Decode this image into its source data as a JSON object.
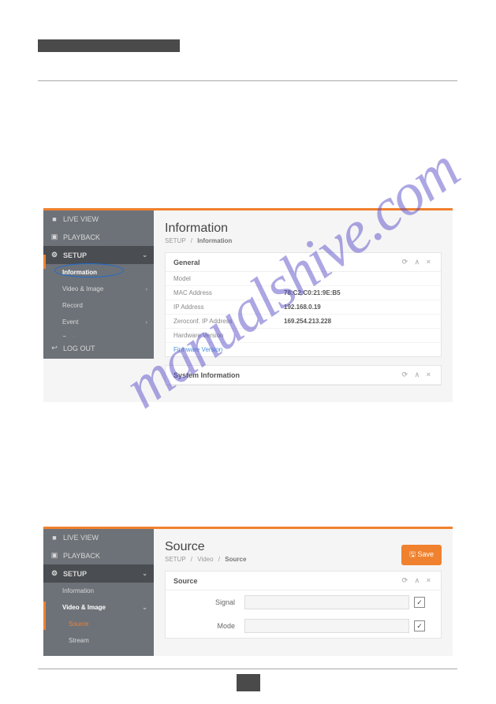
{
  "watermark": "manualshive.com",
  "nav": {
    "liveview": "LIVE VIEW",
    "playback": "PLAYBACK",
    "setup": "SETUP",
    "logout": "LOG OUT"
  },
  "sidebar_items": {
    "information": "Information",
    "video_image": "Video & Image",
    "record": "Record",
    "event": "Event",
    "system": "System",
    "source": "Source",
    "stream": "Stream"
  },
  "screen1": {
    "title": "Information",
    "breadcrumb": {
      "root": "SETUP",
      "last": "Information"
    },
    "panels": {
      "general": {
        "title": "General",
        "rows": [
          {
            "label": "Model",
            "value": ""
          },
          {
            "label": "MAC Address",
            "value": "78:C2:C0:21:9E:B5"
          },
          {
            "label": "IP Address",
            "value": "192.168.0.19"
          },
          {
            "label": "Zeroconf. IP Address",
            "value": "169.254.213.228"
          },
          {
            "label": "Hardware Version",
            "value": ""
          },
          {
            "label": "Firmware Version",
            "value": "",
            "link": true
          }
        ]
      },
      "sysinfo": {
        "title": "System Information"
      }
    }
  },
  "screen2": {
    "title": "Source",
    "breadcrumb": {
      "root": "SETUP",
      "mid": "Video",
      "last": "Source"
    },
    "save_label": "Save",
    "panel": {
      "title": "Source",
      "rows": [
        {
          "label": "Signal"
        },
        {
          "label": "Mode"
        }
      ]
    }
  },
  "panel_controls": "⟳ ∧ ×"
}
